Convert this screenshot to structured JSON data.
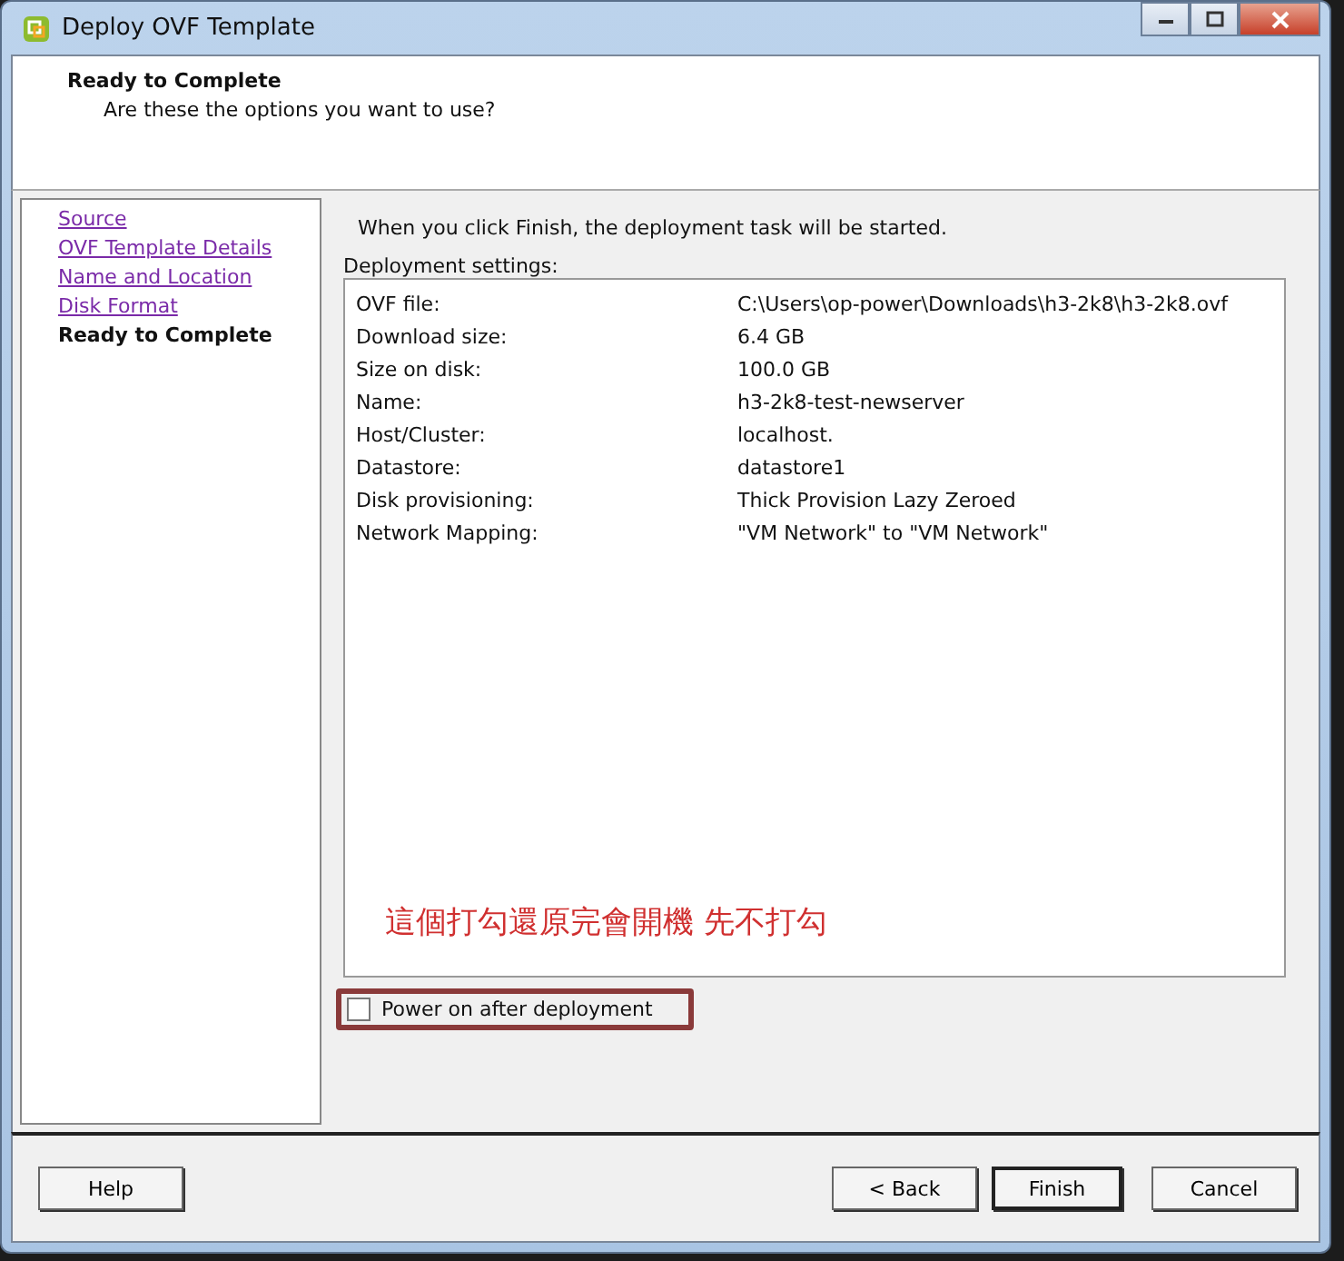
{
  "window": {
    "title": "Deploy OVF Template"
  },
  "header": {
    "title": "Ready to Complete",
    "subtitle": "Are these the options you want to use?"
  },
  "steps": [
    {
      "label": "Source",
      "selected": false
    },
    {
      "label": "OVF Template Details",
      "selected": false
    },
    {
      "label": "Name and Location",
      "selected": false
    },
    {
      "label": "Disk Format",
      "selected": false
    },
    {
      "label": "Ready to Complete",
      "selected": true
    }
  ],
  "intro": "When you click Finish, the deployment task will be started.",
  "settings": {
    "label": "Deployment settings:",
    "rows": [
      {
        "name": "OVF file:",
        "value": "C:\\Users\\op-power\\Downloads\\h3-2k8\\h3-2k8.ovf"
      },
      {
        "name": "Download size:",
        "value": "6.4 GB"
      },
      {
        "name": "Size on disk:",
        "value": "100.0 GB"
      },
      {
        "name": "Name:",
        "value": "h3-2k8-test-newserver"
      },
      {
        "name": "Host/Cluster:",
        "value": "localhost."
      },
      {
        "name": "Datastore:",
        "value": "datastore1"
      },
      {
        "name": "Disk provisioning:",
        "value": "Thick Provision Lazy Zeroed"
      },
      {
        "name": "Network Mapping:",
        "value": "\"VM Network\" to \"VM Network\""
      }
    ]
  },
  "annotation": "這個打勾還原完會開機 先不打勾",
  "power_on": {
    "label": "Power on after deployment",
    "checked": false
  },
  "buttons": {
    "help": "Help",
    "back": "< Back",
    "finish": "Finish",
    "cancel": "Cancel"
  }
}
